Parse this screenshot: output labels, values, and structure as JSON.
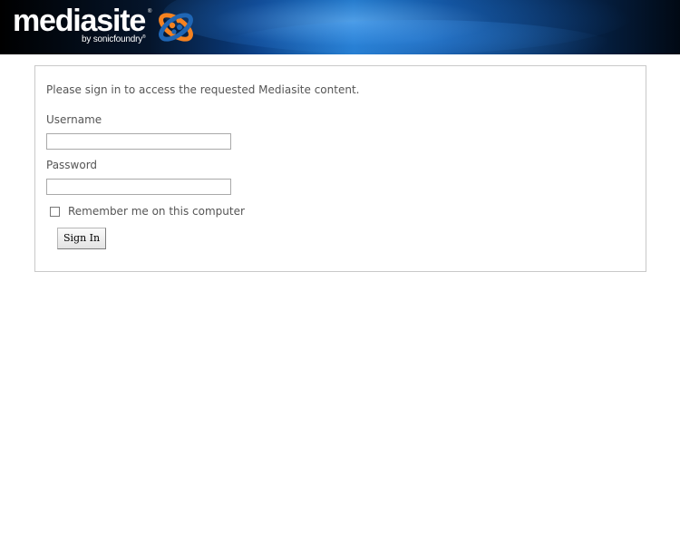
{
  "header": {
    "logo_word": "mediasite",
    "logo_tm": "®",
    "logo_sub": "by sonicfoundry",
    "logo_sub_tm": "®",
    "colors": {
      "orange": "#f58220",
      "blue": "#1f66b5",
      "bg": "#000000"
    }
  },
  "form": {
    "intro": "Please sign in to access the requested Mediasite content.",
    "username_label": "Username",
    "username_value": "",
    "password_label": "Password",
    "password_value": "",
    "remember_label": "Remember me on this computer",
    "remember_checked": false,
    "signin_label": "Sign In"
  }
}
